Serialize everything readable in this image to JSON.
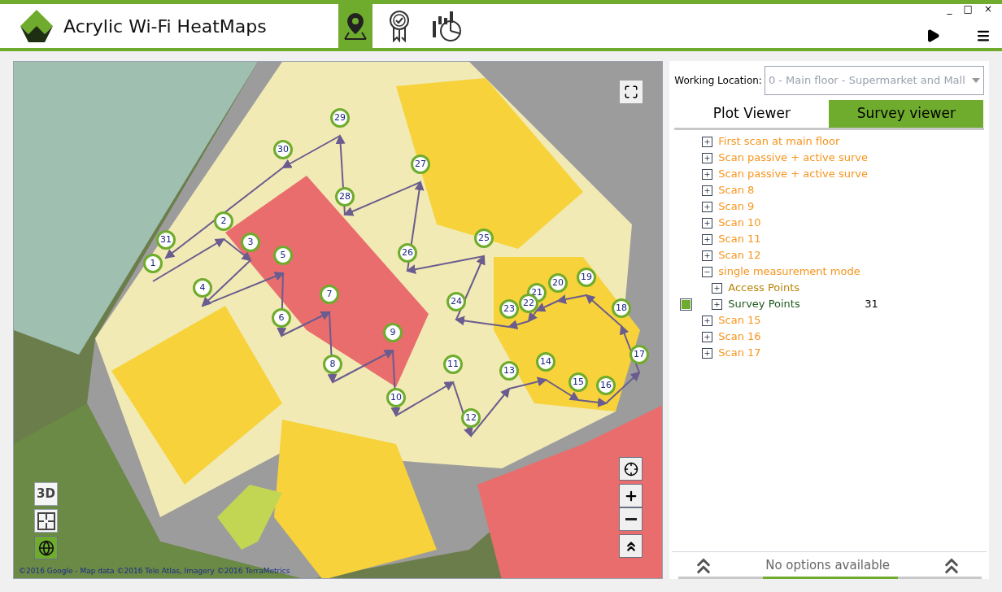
{
  "window": {
    "title": "Acrylic Wi-Fi HeatMaps",
    "controls": [
      "_",
      "□",
      "×"
    ]
  },
  "toolbar": [
    {
      "kind": "map",
      "selected": true
    },
    {
      "kind": "award",
      "selected": false
    },
    {
      "kind": "chart",
      "selected": false
    }
  ],
  "working_location": {
    "label": "Working Location:",
    "value": "0 - Main floor - Supermarket and Mall",
    "disabled": true
  },
  "viewer_tabs": [
    {
      "label": "Plot Viewer",
      "selected": false
    },
    {
      "label": "Survey viewer",
      "selected": true
    }
  ],
  "tree": [
    {
      "label": "First scan at main floor",
      "expanded": false,
      "color": "#f7941d"
    },
    {
      "label": "Scan passive + active surve",
      "expanded": false,
      "color": "#f7941d"
    },
    {
      "label": "Scan passive + active surve",
      "expanded": false,
      "color": "#f7941d"
    },
    {
      "label": "Scan 8",
      "expanded": false,
      "color": "#f7941d"
    },
    {
      "label": "Scan 9",
      "expanded": false,
      "color": "#f7941d"
    },
    {
      "label": "Scan 10",
      "expanded": false,
      "color": "#f7941d"
    },
    {
      "label": "Scan 11",
      "expanded": false,
      "color": "#f7941d"
    },
    {
      "label": "Scan 12",
      "expanded": false,
      "color": "#f7941d"
    },
    {
      "label": "single measurement mode",
      "expanded": true,
      "color": "#f7941d",
      "children": [
        {
          "label": "Access Points",
          "expanded": false,
          "color": "#b8860b"
        },
        {
          "label": "Survey Points",
          "expanded": false,
          "color": "#1e5a1e",
          "checked": true,
          "count": "31"
        }
      ]
    },
    {
      "label": "Scan 15",
      "expanded": false,
      "color": "#f7941d"
    },
    {
      "label": "Scan 16",
      "expanded": false,
      "color": "#f7941d"
    },
    {
      "label": "Scan 17",
      "expanded": false,
      "color": "#f7941d"
    }
  ],
  "map": {
    "pins": [
      "1",
      "2",
      "3",
      "4",
      "5",
      "6",
      "7",
      "8",
      "9",
      "10",
      "11",
      "12",
      "13",
      "14",
      "15",
      "16",
      "17",
      "18",
      "19",
      "20",
      "21",
      "22",
      "23",
      "24",
      "25",
      "26",
      "27",
      "28",
      "29",
      "30",
      "31"
    ],
    "view_3d_button": "3D",
    "attribution": "©2016 Google - Map data ©2016 Tele Atlas, Imagery ©2016 TerraMetrics"
  },
  "options_bar": {
    "text": "No options available"
  }
}
